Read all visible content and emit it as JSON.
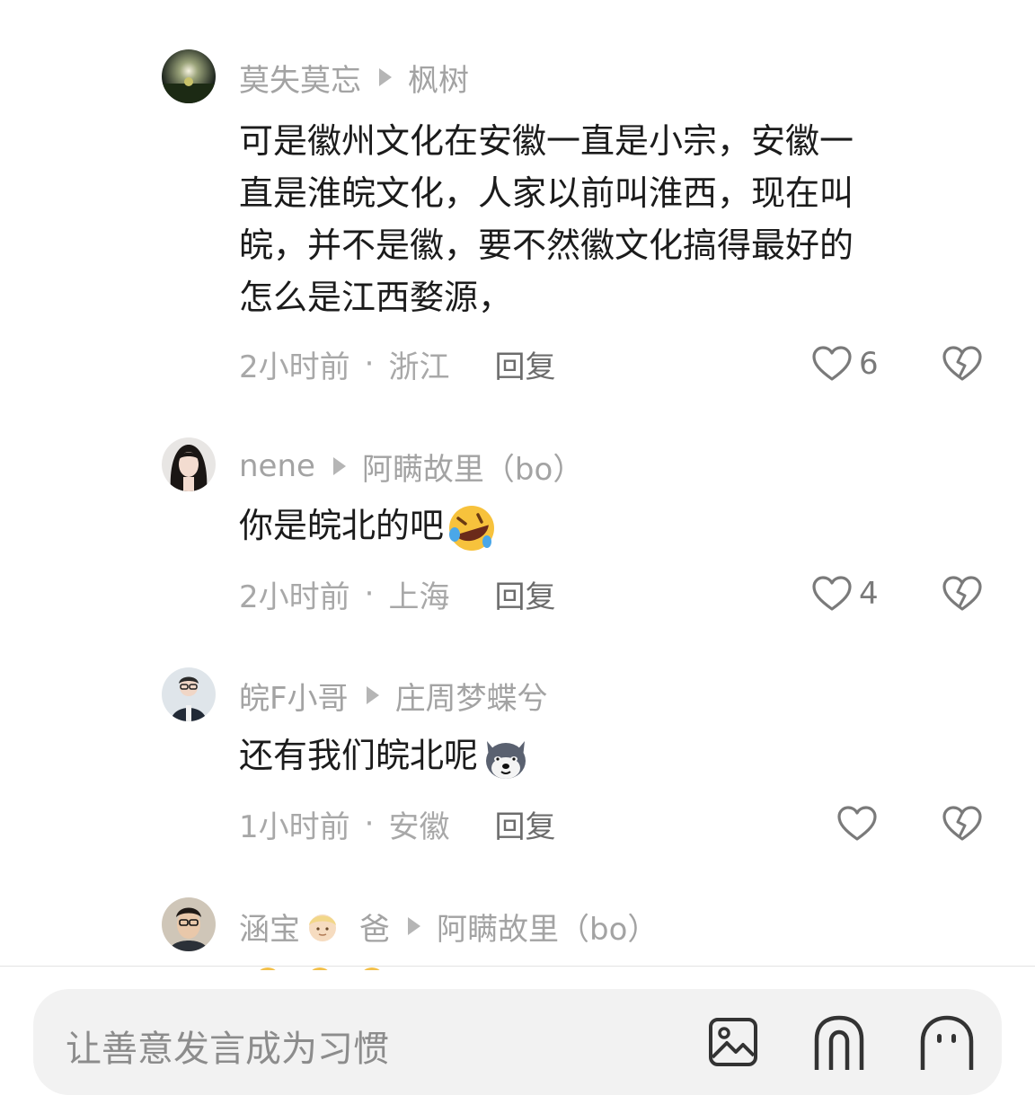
{
  "comments": [
    {
      "user": "莫失莫忘",
      "reply_to": "枫树",
      "text_lines": [
        "可是徽州文化在安徽一直是小宗，安徽一",
        "直是淮皖文化，人家以前叫淮西，现在叫",
        "皖，并不是徽，要不然徽文化搞得最好的",
        "怎么是江西婺源，"
      ],
      "time": "2小时前",
      "location": "浙江",
      "reply_label": "回复",
      "likes": "6"
    },
    {
      "user": "nene",
      "reply_to": "阿瞒故里（bo）",
      "text": "你是皖北的吧",
      "emoji": "rofl-emoji",
      "time": "2小时前",
      "location": "上海",
      "reply_label": "回复",
      "likes": "4"
    },
    {
      "user": "皖F小哥",
      "reply_to": "庄周梦蝶兮",
      "text": "还有我们皖北呢",
      "emoji": "husky-emoji",
      "time": "1小时前",
      "location": "安徽",
      "reply_label": "回复",
      "likes": ""
    },
    {
      "user_part1": "涵宝",
      "user_emoji": "man-blond-emoji",
      "user_part2": "爸",
      "reply_to": "阿瞒故里（bo）"
    }
  ],
  "input": {
    "placeholder": "让善意发言成为习惯",
    "icons": [
      "image-icon",
      "mention-icon",
      "emoji-icon"
    ]
  },
  "colors": {
    "name": "#a3a3a3",
    "content": "#1b1b1b",
    "meta": "#a8a8a8",
    "input_bg": "#f2f2f2"
  }
}
